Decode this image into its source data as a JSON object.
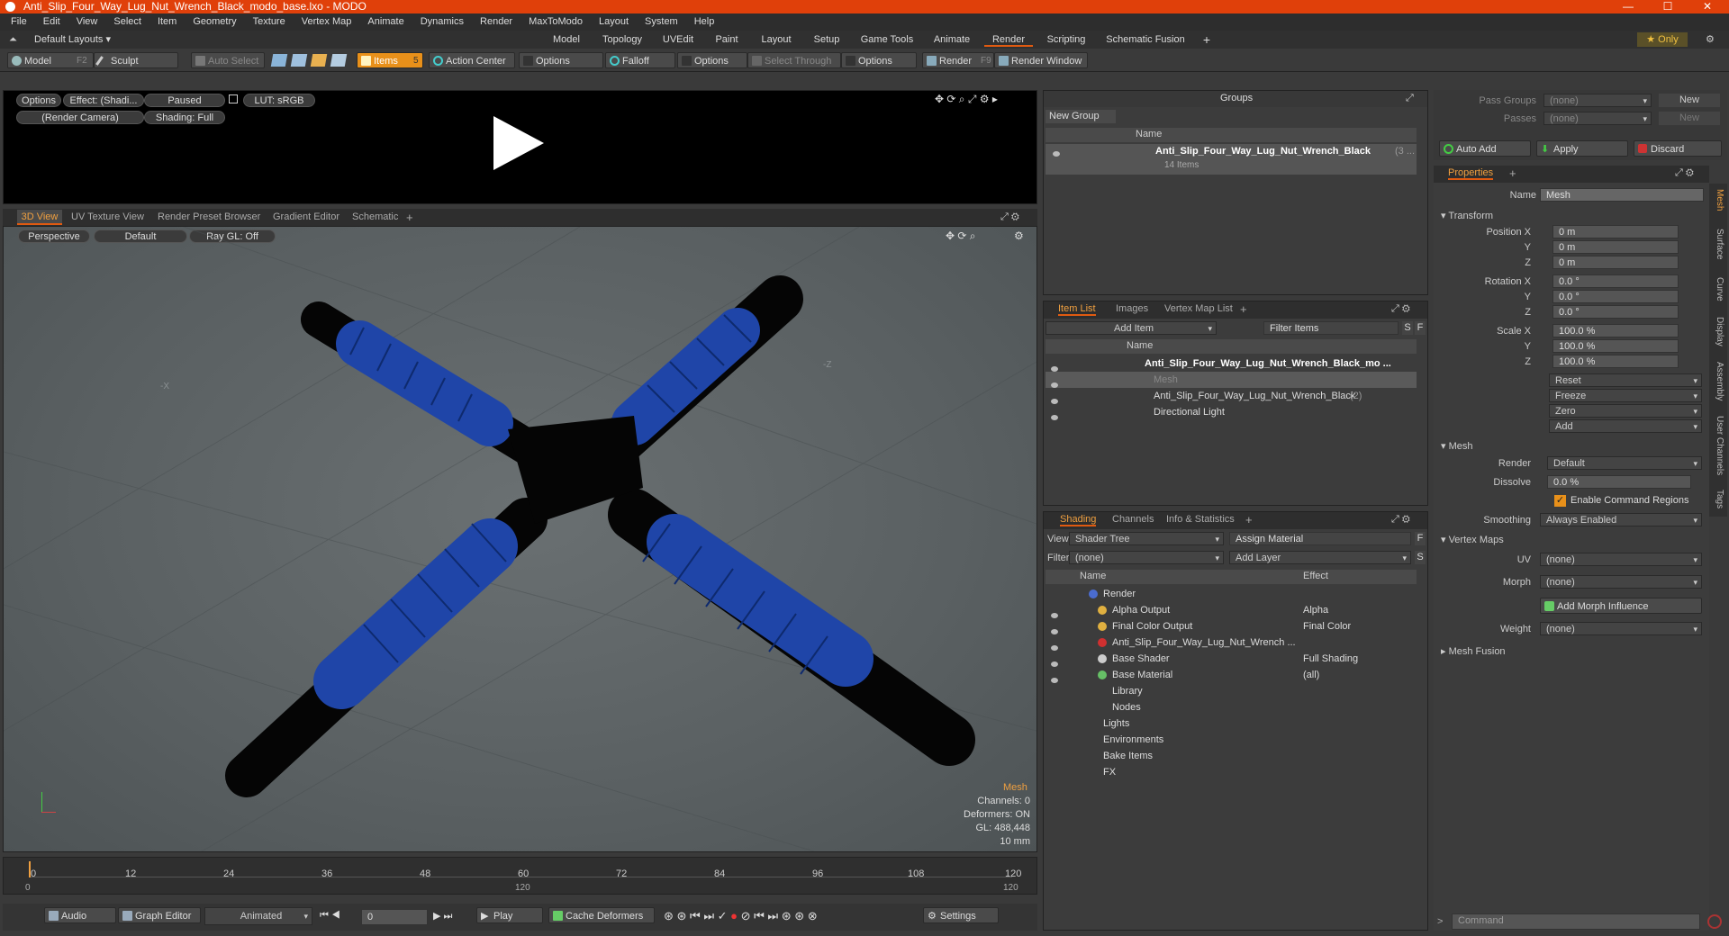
{
  "window": {
    "title": "Anti_Slip_Four_Way_Lug_Nut_Wrench_Black_modo_base.lxo - MODO",
    "minimize": "—",
    "maximize": "☐",
    "close": "✕"
  },
  "menu": [
    "File",
    "Edit",
    "View",
    "Select",
    "Item",
    "Geometry",
    "Texture",
    "Vertex Map",
    "Animate",
    "Dynamics",
    "Render",
    "MaxToModo",
    "Layout",
    "System",
    "Help"
  ],
  "layouts": {
    "selector": "Default Layouts ▾",
    "tabs": [
      "Model",
      "Topology",
      "UVEdit",
      "Paint",
      "Layout",
      "Setup",
      "Game Tools",
      "Animate",
      "Render",
      "Scripting",
      "Schematic Fusion"
    ],
    "active": "Render",
    "add": "+",
    "only": "★ Only",
    "settings": "⚙"
  },
  "toolbar": {
    "model": "Model",
    "model_key": "F2",
    "sculpt": "Sculpt",
    "auto_select": "Auto Select",
    "items": "Items",
    "items_key": "5",
    "action_center": "Action Center",
    "options1": "Options",
    "falloff": "Falloff",
    "options2": "Options",
    "select_through": "Select Through",
    "options3": "Options",
    "render": "Render",
    "render_key": "F9",
    "render_window": "Render Window"
  },
  "preview": {
    "options": "Options",
    "effect": "Effect: (Shadi...",
    "paused": "Paused",
    "lut": "LUT: sRGB",
    "camera": "(Render Camera)",
    "shading": "Shading: Full"
  },
  "viewport": {
    "tabs": [
      "3D View",
      "UV Texture View",
      "Render Preset Browser",
      "Gradient Editor",
      "Schematic"
    ],
    "active": "3D View",
    "add": "+",
    "perspective": "Perspective",
    "default": "Default",
    "raygl": "Ray GL: Off",
    "axis_x": "-X",
    "axis_z": "-Z",
    "info": {
      "type": "Mesh",
      "channels": "Channels: 0",
      "deformers": "Deformers: ON",
      "gl": "GL: 488,448",
      "size": "10 mm"
    }
  },
  "timeline": {
    "ticks": [
      "0",
      "12",
      "24",
      "36",
      "48",
      "60",
      "72",
      "84",
      "96",
      "108",
      "120"
    ],
    "sub_start": "0",
    "sub_mid": "120",
    "sub_end": "120"
  },
  "transport": {
    "audio": "Audio",
    "graph_editor": "Graph Editor",
    "animated": "Animated",
    "frame": "0",
    "play": "Play",
    "cache": "Cache Deformers",
    "settings": "Settings"
  },
  "groups": {
    "title": "Groups",
    "new_group": "New Group",
    "col_name": "Name",
    "item": "Anti_Slip_Four_Way_Lug_Nut_Wrench_Black",
    "item_count": "(3 ...",
    "item_sub": "14 Items"
  },
  "itemlist": {
    "tabs": [
      "Item List",
      "Images",
      "Vertex Map List"
    ],
    "active": "Item List",
    "add": "+",
    "add_item": "Add Item",
    "filter": "Filter Items",
    "s": "S",
    "f": "F",
    "col_name": "Name",
    "rows": [
      {
        "label": "Anti_Slip_Four_Way_Lug_Nut_Wrench_Black_mo ...",
        "bold": true,
        "indent": 0
      },
      {
        "label": "Mesh",
        "bold": false,
        "indent": 1
      },
      {
        "label": "Anti_Slip_Four_Way_Lug_Nut_Wrench_Black",
        "count": "(2)",
        "bold": false,
        "indent": 1
      },
      {
        "label": "Directional Light",
        "bold": false,
        "indent": 1
      }
    ]
  },
  "shading": {
    "tabs": [
      "Shading",
      "Channels",
      "Info & Statistics"
    ],
    "active": "Shading",
    "add": "+",
    "view_label": "View",
    "view_value": "Shader Tree",
    "assign": "Assign Material",
    "filter_label": "Filter",
    "filter_value": "(none)",
    "add_layer": "Add Layer",
    "f": "F",
    "s": "S",
    "col_name": "Name",
    "col_effect": "Effect",
    "rows": [
      {
        "name": "Render",
        "effect": "",
        "indent": 0
      },
      {
        "name": "Alpha Output",
        "effect": "Alpha",
        "indent": 1
      },
      {
        "name": "Final Color Output",
        "effect": "Final Color",
        "indent": 1
      },
      {
        "name": "Anti_Slip_Four_Way_Lug_Nut_Wrench ...",
        "effect": "",
        "indent": 1
      },
      {
        "name": "Base Shader",
        "effect": "Full Shading",
        "indent": 1
      },
      {
        "name": "Base Material",
        "effect": "(all)",
        "indent": 1
      },
      {
        "name": "Library",
        "effect": "",
        "indent": 1
      },
      {
        "name": "Nodes",
        "effect": "",
        "indent": 1
      },
      {
        "name": "Lights",
        "effect": "",
        "indent": 0
      },
      {
        "name": "Environments",
        "effect": "",
        "indent": 0
      },
      {
        "name": "Bake Items",
        "effect": "",
        "indent": 0
      },
      {
        "name": "FX",
        "effect": "",
        "indent": 0
      }
    ]
  },
  "passes": {
    "pass_groups_label": "Pass Groups",
    "pass_groups": "(none)",
    "passes_label": "Passes",
    "passes": "(none)",
    "new1": "New",
    "new2": "New",
    "auto_add": "Auto Add",
    "apply": "Apply",
    "discard": "Discard"
  },
  "properties": {
    "tab": "Properties",
    "add": "+",
    "name_label": "Name",
    "name": "Mesh",
    "transform": "Transform",
    "pos_label": "Position X",
    "pos": [
      "0 m",
      "0 m",
      "0 m"
    ],
    "rot_label": "Rotation X",
    "rot": [
      "0.0 °",
      "0.0 °",
      "0.0 °"
    ],
    "scale_label": "Scale X",
    "scale": [
      "100.0 %",
      "100.0 %",
      "100.0 %"
    ],
    "y": "Y",
    "z": "Z",
    "actions": [
      "Reset",
      "Freeze",
      "Zero",
      "Add"
    ],
    "mesh": "Mesh",
    "render_label": "Render",
    "render": "Default",
    "dissolve_label": "Dissolve",
    "dissolve": "0.0 %",
    "enable_cmd": "Enable Command Regions",
    "smoothing_label": "Smoothing",
    "smoothing": "Always Enabled",
    "vertex_maps": "Vertex Maps",
    "uv_label": "UV",
    "uv": "(none)",
    "morph_label": "Morph",
    "morph": "(none)",
    "add_morph": "Add Morph Influence",
    "weight_label": "Weight",
    "weight": "(none)",
    "mesh_fusion": "Mesh Fusion",
    "side_tabs": [
      "Mesh",
      "Surface",
      "Curve",
      "Display",
      "Assembly",
      "User Channels",
      "Tags"
    ],
    "command": "Command"
  },
  "colors": {
    "accent": "#e8901a",
    "title": "#e0400a",
    "mesh_blue": "#1f45a8",
    "viewport_bg": "#5e6466"
  }
}
